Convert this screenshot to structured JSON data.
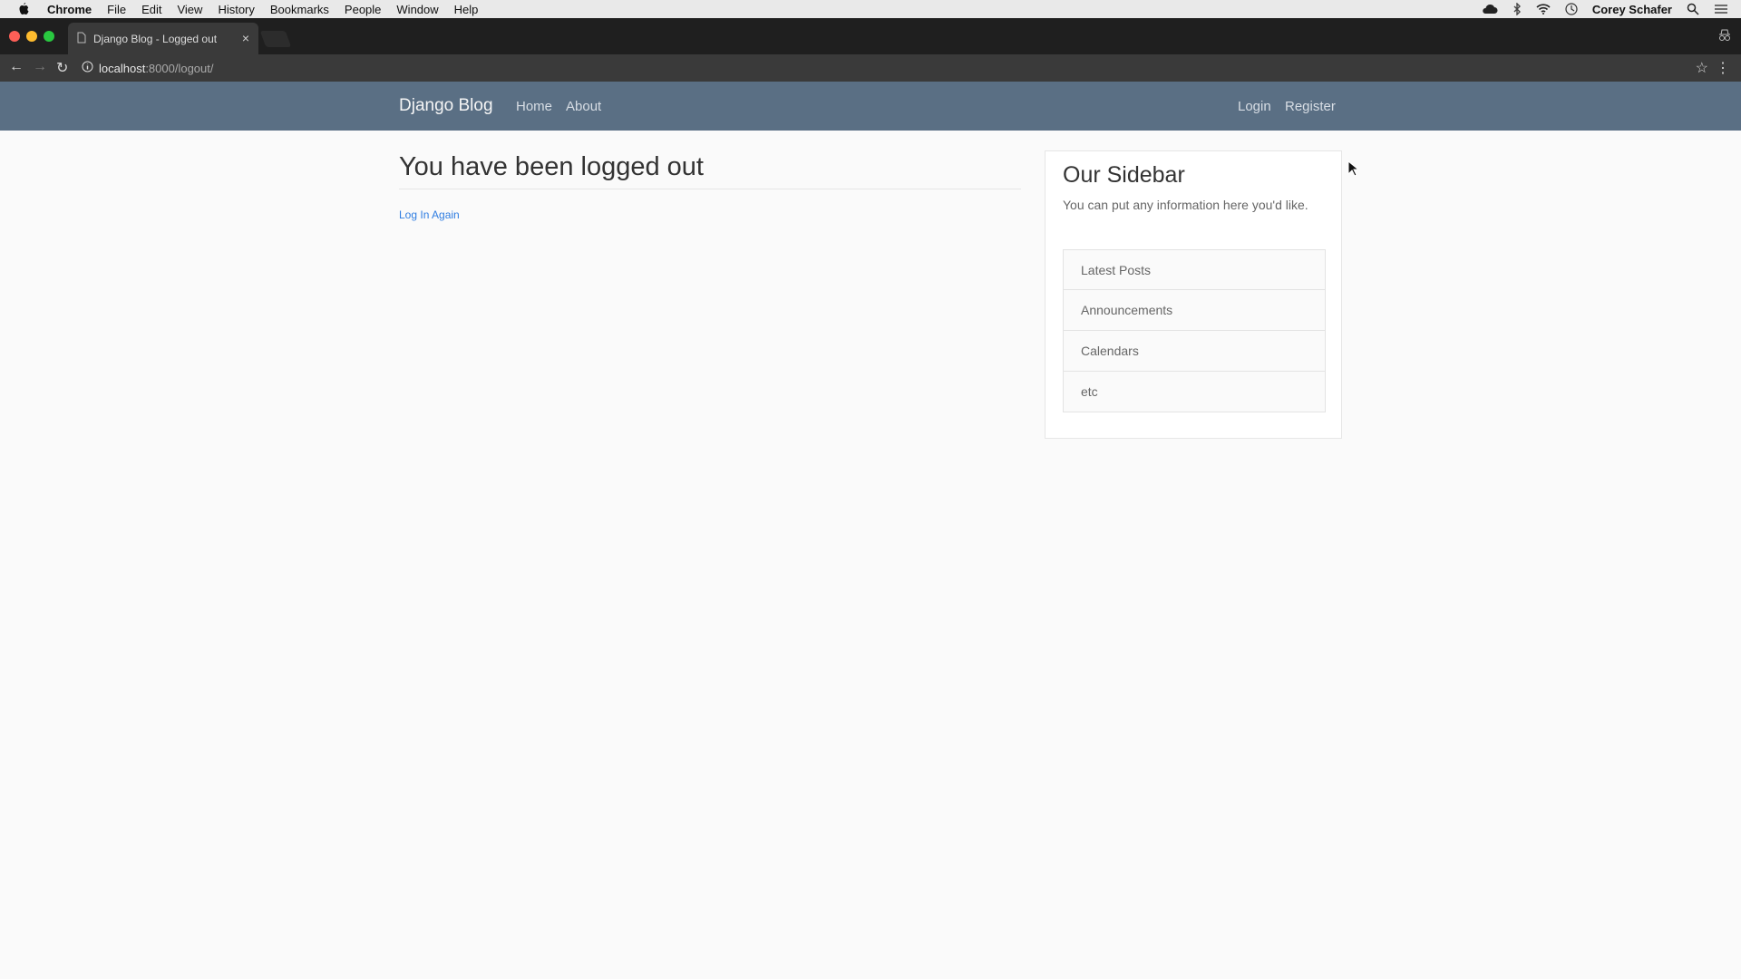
{
  "menubar": {
    "app": "Chrome",
    "items": [
      "File",
      "Edit",
      "View",
      "History",
      "Bookmarks",
      "People",
      "Window",
      "Help"
    ],
    "user": "Corey Schafer"
  },
  "browser": {
    "tab_title": "Django Blog - Logged out",
    "url_host": "localhost",
    "url_path": ":8000/logout/"
  },
  "site": {
    "brand": "Django Blog",
    "nav_left": [
      "Home",
      "About"
    ],
    "nav_right": [
      "Login",
      "Register"
    ]
  },
  "main": {
    "title": "You have been logged out",
    "link": "Log In Again"
  },
  "sidebar": {
    "heading": "Our Sidebar",
    "description": "You can put any information here you'd like.",
    "items": [
      "Latest Posts",
      "Announcements",
      "Calendars",
      "etc"
    ]
  },
  "colors": {
    "navbar": "#5a6f84",
    "link": "#2f7de1",
    "page_bg": "#fafafa"
  }
}
